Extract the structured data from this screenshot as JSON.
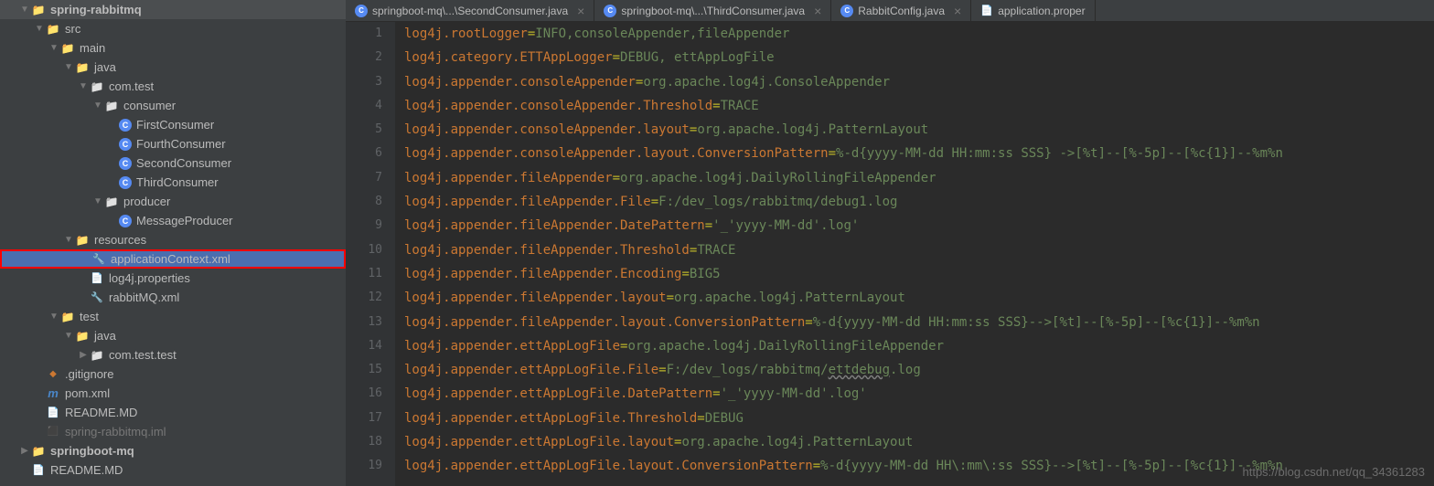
{
  "tree": [
    {
      "indent": 22,
      "arrow": "down",
      "icon": "module",
      "label": "spring-rabbitmq",
      "bold": true
    },
    {
      "indent": 38,
      "arrow": "down",
      "icon": "folder",
      "label": "src"
    },
    {
      "indent": 54,
      "arrow": "down",
      "icon": "folder",
      "label": "main"
    },
    {
      "indent": 70,
      "arrow": "down",
      "icon": "folder",
      "label": "java"
    },
    {
      "indent": 86,
      "arrow": "down",
      "icon": "package",
      "label": "com.test"
    },
    {
      "indent": 102,
      "arrow": "down",
      "icon": "package",
      "label": "consumer"
    },
    {
      "indent": 118,
      "arrow": "none",
      "icon": "class",
      "label": "FirstConsumer"
    },
    {
      "indent": 118,
      "arrow": "none",
      "icon": "class",
      "label": "FourthConsumer"
    },
    {
      "indent": 118,
      "arrow": "none",
      "icon": "class",
      "label": "SecondConsumer"
    },
    {
      "indent": 118,
      "arrow": "none",
      "icon": "class",
      "label": "ThirdConsumer"
    },
    {
      "indent": 102,
      "arrow": "down",
      "icon": "package",
      "label": "producer"
    },
    {
      "indent": 118,
      "arrow": "none",
      "icon": "class",
      "label": "MessageProducer"
    },
    {
      "indent": 70,
      "arrow": "down",
      "icon": "folder",
      "label": "resources"
    },
    {
      "indent": 86,
      "arrow": "none",
      "icon": "xml",
      "label": "applicationContext.xml",
      "selected": true
    },
    {
      "indent": 86,
      "arrow": "none",
      "icon": "props",
      "label": "log4j.properties"
    },
    {
      "indent": 86,
      "arrow": "none",
      "icon": "xml",
      "label": "rabbitMQ.xml"
    },
    {
      "indent": 54,
      "arrow": "down",
      "icon": "folder",
      "label": "test"
    },
    {
      "indent": 70,
      "arrow": "down",
      "icon": "folder",
      "label": "java"
    },
    {
      "indent": 86,
      "arrow": "right",
      "icon": "package",
      "label": "com.test.test"
    },
    {
      "indent": 38,
      "arrow": "none",
      "icon": "git",
      "label": ".gitignore"
    },
    {
      "indent": 38,
      "arrow": "none",
      "icon": "maven",
      "label": "pom.xml"
    },
    {
      "indent": 38,
      "arrow": "none",
      "icon": "md",
      "label": "README.MD"
    },
    {
      "indent": 38,
      "arrow": "none",
      "icon": "iml",
      "label": "spring-rabbitmq.iml",
      "dim": true
    },
    {
      "indent": 22,
      "arrow": "right",
      "icon": "module",
      "label": "springboot-mq",
      "bold": true
    },
    {
      "indent": 22,
      "arrow": "none",
      "icon": "md",
      "label": "README.MD"
    }
  ],
  "tabs": [
    {
      "icon": "java",
      "label": "springboot-mq\\...\\SecondConsumer.java",
      "close": true
    },
    {
      "icon": "java",
      "label": "springboot-mq\\...\\ThirdConsumer.java",
      "close": true
    },
    {
      "icon": "java",
      "label": "RabbitConfig.java",
      "close": true
    },
    {
      "icon": "props",
      "label": "application.proper",
      "close": false
    }
  ],
  "code_lines": [
    [
      {
        "c": "orange",
        "t": "log4j.rootLogger"
      },
      {
        "c": "yellow",
        "t": "="
      },
      {
        "c": "green",
        "t": "INFO,consoleAppender,fileAppender"
      }
    ],
    [
      {
        "c": "orange",
        "t": "log4j.category.ETTAppLogger"
      },
      {
        "c": "yellow",
        "t": "="
      },
      {
        "c": "green",
        "t": "DEBUG, ettAppLogFile"
      }
    ],
    [
      {
        "c": "orange",
        "t": "log4j.appender.consoleAppender"
      },
      {
        "c": "yellow",
        "t": "="
      },
      {
        "c": "green",
        "t": "org.apache.log4j.ConsoleAppender"
      }
    ],
    [
      {
        "c": "orange",
        "t": "log4j.appender.consoleAppender.Threshold"
      },
      {
        "c": "yellow",
        "t": "="
      },
      {
        "c": "green",
        "t": "TRACE"
      }
    ],
    [
      {
        "c": "orange",
        "t": "log4j.appender.consoleAppender.layout"
      },
      {
        "c": "yellow",
        "t": "="
      },
      {
        "c": "green",
        "t": "org.apache.log4j.PatternLayout"
      }
    ],
    [
      {
        "c": "orange",
        "t": "log4j.appender.consoleAppender.layout.ConversionPattern"
      },
      {
        "c": "yellow",
        "t": "="
      },
      {
        "c": "green",
        "t": "%-d{yyyy-MM-dd HH:mm:ss SSS} ->[%t]--[%-5p]--[%c{1}]--%m%n"
      }
    ],
    [
      {
        "c": "orange",
        "t": "log4j.appender.fileAppender"
      },
      {
        "c": "yellow",
        "t": "="
      },
      {
        "c": "green",
        "t": "org.apache.log4j.DailyRollingFileAppender"
      }
    ],
    [
      {
        "c": "orange",
        "t": "log4j.appender.fileAppender.File"
      },
      {
        "c": "yellow",
        "t": "="
      },
      {
        "c": "green",
        "t": "F:/dev_logs/rabbitmq/debug1.log"
      }
    ],
    [
      {
        "c": "orange",
        "t": "log4j.appender.fileAppender.DatePattern"
      },
      {
        "c": "yellow",
        "t": "="
      },
      {
        "c": "green",
        "t": "'_'yyyy-MM-dd'.log'"
      }
    ],
    [
      {
        "c": "orange",
        "t": "log4j.appender.fileAppender.Threshold"
      },
      {
        "c": "yellow",
        "t": "="
      },
      {
        "c": "green",
        "t": "TRACE"
      }
    ],
    [
      {
        "c": "orange",
        "t": "log4j.appender.fileAppender.Encoding"
      },
      {
        "c": "yellow",
        "t": "="
      },
      {
        "c": "green",
        "t": "BIG5"
      }
    ],
    [
      {
        "c": "orange",
        "t": "log4j.appender.fileAppender.layout"
      },
      {
        "c": "yellow",
        "t": "="
      },
      {
        "c": "green",
        "t": "org.apache.log4j.PatternLayout"
      }
    ],
    [
      {
        "c": "orange",
        "t": "log4j.appender.fileAppender.layout.ConversionPattern"
      },
      {
        "c": "yellow",
        "t": "="
      },
      {
        "c": "green",
        "t": "%-d{yyyy-MM-dd HH:mm:ss SSS}-->[%t]--[%-5p]--[%c{1}]--%m%n"
      }
    ],
    [
      {
        "c": "orange",
        "t": "log4j.appender.ettAppLogFile"
      },
      {
        "c": "yellow",
        "t": "="
      },
      {
        "c": "green",
        "t": "org.apache.log4j.DailyRollingFileAppender"
      }
    ],
    [
      {
        "c": "orange",
        "t": "log4j.appender.ettAppLogFile.File"
      },
      {
        "c": "yellow",
        "t": "="
      },
      {
        "c": "green",
        "t": "F:/dev_logs/rabbitmq/"
      },
      {
        "c": "green",
        "t": "ettdebug",
        "u": true
      },
      {
        "c": "green",
        "t": ".log"
      }
    ],
    [
      {
        "c": "orange",
        "t": "log4j.appender.ettAppLogFile.DatePattern"
      },
      {
        "c": "yellow",
        "t": "="
      },
      {
        "c": "green",
        "t": "'_'yyyy-MM-dd'.log'"
      }
    ],
    [
      {
        "c": "orange",
        "t": "log4j.appender.ettAppLogFile.Threshold"
      },
      {
        "c": "yellow",
        "t": "="
      },
      {
        "c": "green",
        "t": "DEBUG"
      }
    ],
    [
      {
        "c": "orange",
        "t": "log4j.appender.ettAppLogFile.layout"
      },
      {
        "c": "yellow",
        "t": "="
      },
      {
        "c": "green",
        "t": "org.apache.log4j.PatternLayout"
      }
    ],
    [
      {
        "c": "orange",
        "t": "log4j.appender.ettAppLogFile.layout.ConversionPattern"
      },
      {
        "c": "yellow",
        "t": "="
      },
      {
        "c": "green",
        "t": "%-d{yyyy-MM-dd HH\\:mm\\:ss SSS}-->[%t]--[%-5p]--[%c{1}]--%m%n"
      }
    ]
  ],
  "watermark": "https://blog.csdn.net/qq_34361283"
}
